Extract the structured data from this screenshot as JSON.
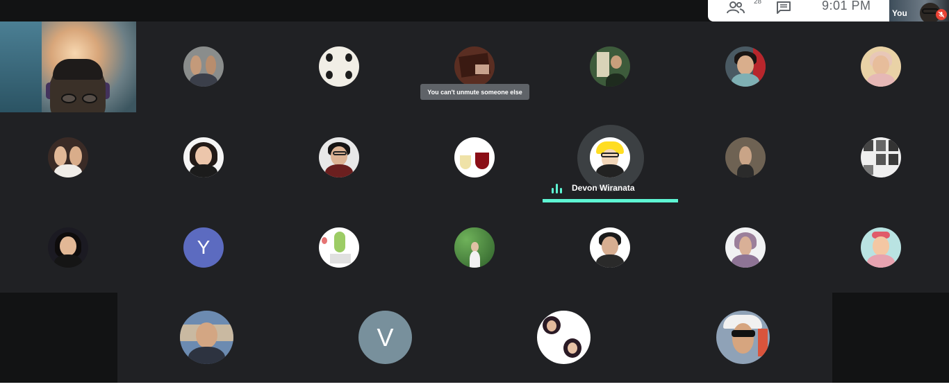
{
  "topbar": {
    "people_count": "28",
    "time": "9:01 PM",
    "self_label": "You"
  },
  "speaker": {
    "name": "Devon Wiranata"
  },
  "tooltip": {
    "text": "You can't unmute someone else"
  },
  "letter_avatars": [
    {
      "letter": "Y",
      "color": "#5c6bc0"
    },
    {
      "letter": "V",
      "color": "#78909c"
    }
  ],
  "colors": {
    "grid_bg": "#202124",
    "side_bg": "#121314",
    "speaker_accent": "#5ef5d3",
    "mute_red": "#ea4335"
  }
}
